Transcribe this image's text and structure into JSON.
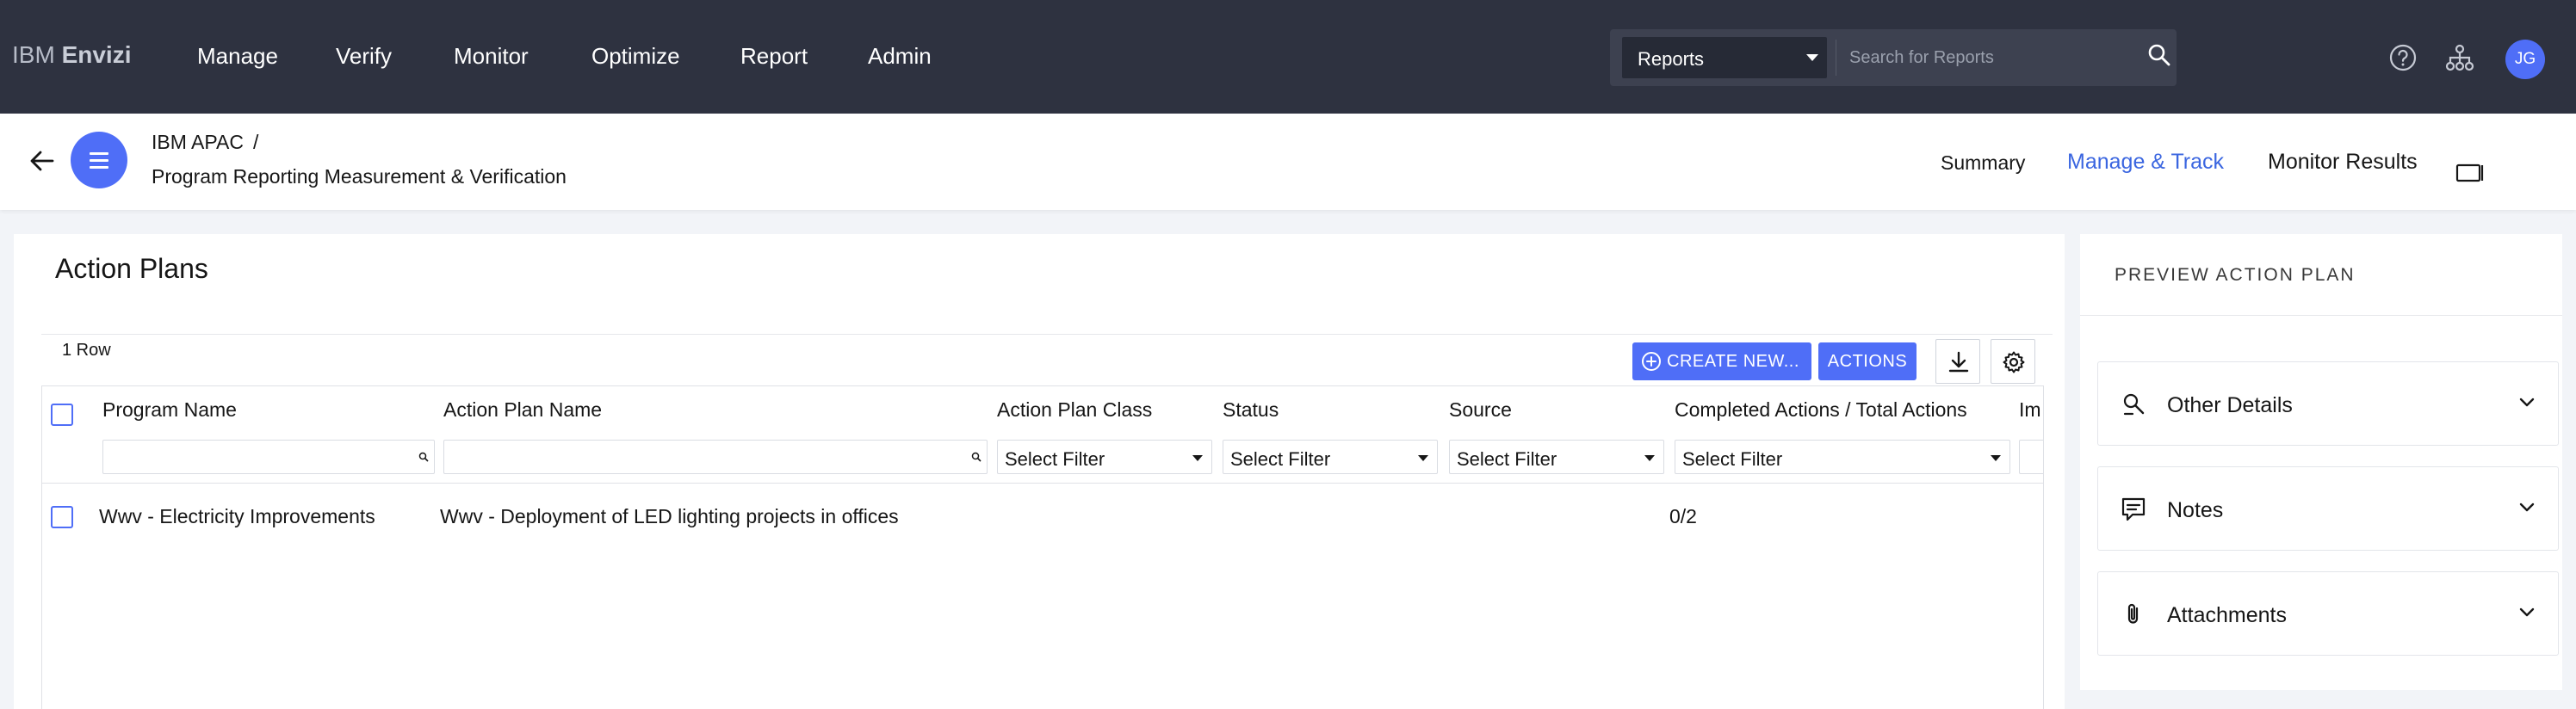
{
  "app": {
    "brand_prefix": "IBM",
    "brand_name": "Envizi",
    "nav": [
      "Manage",
      "Verify",
      "Monitor",
      "Optimize",
      "Report",
      "Admin"
    ],
    "search": {
      "scope": "Reports",
      "placeholder": "Search for Reports"
    },
    "user_initials": "JG"
  },
  "subheader": {
    "breadcrumb_root": "IBM APAC",
    "breadcrumb_sep": "/",
    "page_name": "Program Reporting Measurement & Verification",
    "tabs": [
      "Summary",
      "Manage & Track",
      "Monitor Results"
    ],
    "active_tab": "Manage & Track"
  },
  "main": {
    "title": "Action Plans",
    "row_count": "1 Row",
    "create_label": "CREATE NEW...",
    "actions_label": "ACTIONS",
    "columns": [
      "Program Name",
      "Action Plan Name",
      "Action Plan Class",
      "Status",
      "Source",
      "Completed Actions / Total Actions",
      "Im"
    ],
    "filter_placeholder": "Select Filter",
    "rows": [
      {
        "program_name": "Wwv - Electricity Improvements",
        "action_plan_name": "Wwv - Deployment of LED lighting projects in offices",
        "action_plan_class": "",
        "status": "",
        "source": "",
        "completed": "0/2"
      }
    ]
  },
  "preview": {
    "title": "PREVIEW ACTION PLAN",
    "sections": [
      "Other Details",
      "Notes",
      "Attachments"
    ]
  },
  "colors": {
    "topbar": "#2e3240",
    "accent": "#4f6ef7",
    "active_tab": "#3b66e0"
  }
}
